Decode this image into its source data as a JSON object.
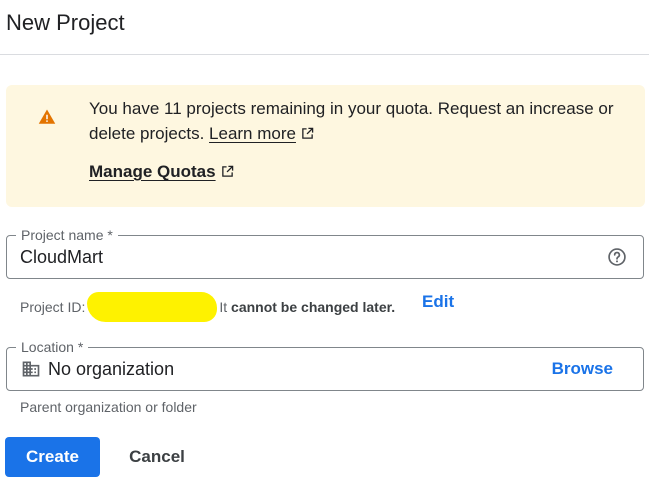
{
  "header": {
    "title": "New Project"
  },
  "banner": {
    "message": "You have 11 projects remaining in your quota. Request an increase or delete projects.",
    "learn_more": "Learn more",
    "manage_quotas": "Manage Quotas",
    "background_color": "#fef7e0",
    "warning_color": "#e37400"
  },
  "project_name": {
    "label": "Project name *",
    "value": "CloudMart",
    "help_icon": "help-circle-icon"
  },
  "project_id": {
    "prefix": "Project ID:",
    "suffix_pre": "It",
    "suffix_bold": "cannot be changed later.",
    "edit_label": "Edit"
  },
  "location": {
    "label": "Location *",
    "value": "No organization",
    "icon": "organization-icon",
    "browse_label": "Browse",
    "helper": "Parent organization or folder"
  },
  "actions": {
    "create_label": "Create",
    "cancel_label": "Cancel",
    "primary_color": "#1a73e8"
  }
}
